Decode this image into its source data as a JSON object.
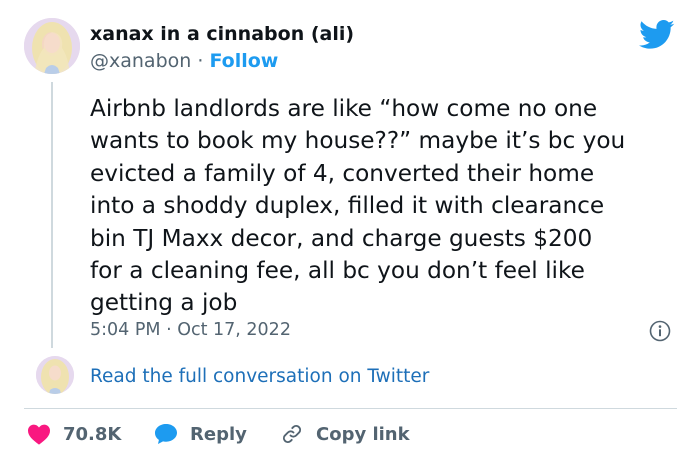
{
  "author": {
    "display_name": "xanax in a cinnabon (ali)",
    "handle": "@xanabon",
    "separator": "·",
    "follow_label": "Follow"
  },
  "tweet": {
    "lines": [
      "Airbnb landlords are like “how come no one",
      "wants to book my house??” maybe it’s bc you",
      "evicted a family of 4, converted their home",
      "into a shoddy duplex, filled it with clearance",
      "bin TJ Maxx decor, and charge guests $200",
      "for a cleaning fee, all bc you don’t feel like",
      "getting a job"
    ],
    "timestamp": "5:04 PM · Oct 17, 2022"
  },
  "conversation_link": "Read the full conversation on Twitter",
  "actions": {
    "like_count": "70.8K",
    "reply_label": "Reply",
    "copy_link_label": "Copy link"
  },
  "icons": {
    "logo": "twitter-bird-icon",
    "info": "info-icon",
    "like": "heart-icon",
    "reply": "speech-bubble-icon",
    "copy": "link-icon"
  },
  "colors": {
    "accent": "#1d9bf0",
    "like": "#f91880",
    "secondary_text": "#536471",
    "primary_text": "#0f1419",
    "divider": "#cfd9de"
  }
}
